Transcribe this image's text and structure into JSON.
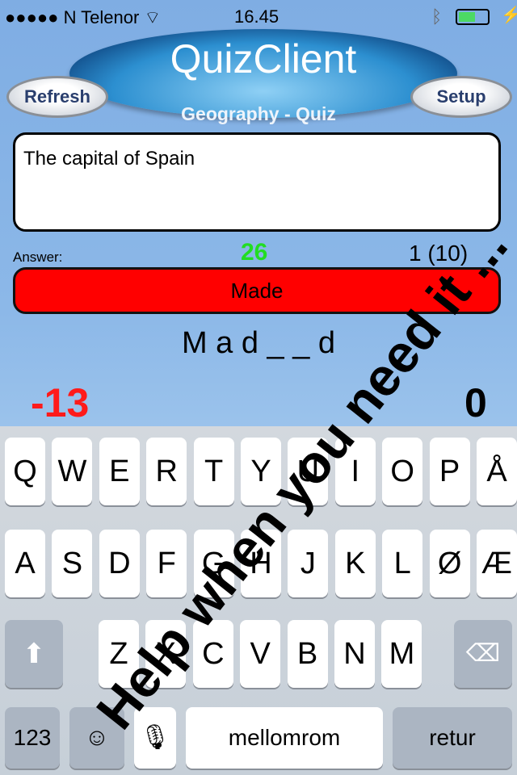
{
  "status_bar": {
    "signal": "●●●●●",
    "carrier": "N Telenor",
    "time": "16.45",
    "battery_color": "#4cd964"
  },
  "header": {
    "logo": "QuizClient",
    "refresh_label": "Refresh",
    "setup_label": "Setup",
    "quiz_title": "Geography - Quiz"
  },
  "question": "The capital of Spain",
  "answer_label": "Answer:",
  "counter_green": "26",
  "progress": "1 (10)",
  "answer_value": "Made",
  "hint": "M a d _ _ d",
  "score_left": "-13",
  "score_right": "0",
  "overlay_text": "Help when you need it ...",
  "keyboard": {
    "row1": [
      "Q",
      "W",
      "E",
      "R",
      "T",
      "Y",
      "U",
      "I",
      "O",
      "P",
      "Å"
    ],
    "row2": [
      "A",
      "S",
      "D",
      "F",
      "G",
      "H",
      "J",
      "K",
      "L",
      "Ø",
      "Æ"
    ],
    "row3": [
      "Z",
      "X",
      "C",
      "V",
      "B",
      "N",
      "M"
    ],
    "numbers": "123",
    "space": "mellomrom",
    "return": "retur"
  },
  "colors": {
    "answer_bg": "#ff0000",
    "green": "#22dd22",
    "red": "#ff1a1a"
  }
}
